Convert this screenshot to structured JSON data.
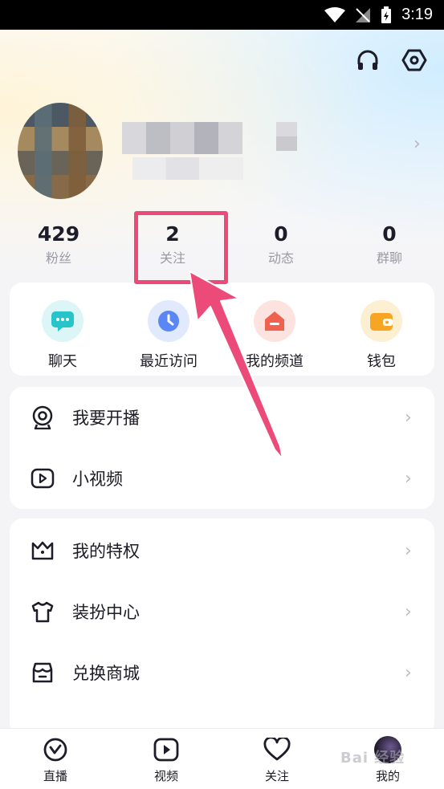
{
  "status_bar": {
    "time": "3:19"
  },
  "profile": {
    "stats": [
      {
        "value": "429",
        "label": "粉丝"
      },
      {
        "value": "2",
        "label": "关注"
      },
      {
        "value": "0",
        "label": "动态"
      },
      {
        "value": "0",
        "label": "群聊"
      }
    ]
  },
  "quick_actions": [
    {
      "label": "聊天",
      "icon": "chat-bubble-icon",
      "color": "#27c4c9"
    },
    {
      "label": "最近访问",
      "icon": "clock-icon",
      "color": "#5b86f5"
    },
    {
      "label": "我的频道",
      "icon": "channel-house-icon",
      "color": "#f0614e"
    },
    {
      "label": "钱包",
      "icon": "wallet-icon",
      "color": "#f6a623"
    }
  ],
  "menu_group_1": [
    {
      "label": "我要开播",
      "icon": "live-camera-icon"
    },
    {
      "label": "小视频",
      "icon": "video-play-icon"
    }
  ],
  "menu_group_2": [
    {
      "label": "我的特权",
      "icon": "crown-icon"
    },
    {
      "label": "装扮中心",
      "icon": "tshirt-icon"
    },
    {
      "label": "兑换商城",
      "icon": "store-icon"
    }
  ],
  "tabbar": [
    {
      "label": "直播",
      "icon": "live-check-icon"
    },
    {
      "label": "视频",
      "icon": "video-play-icon"
    },
    {
      "label": "关注",
      "icon": "heart-icon"
    },
    {
      "label": "我的",
      "icon": "avatar-icon"
    }
  ],
  "watermark": "Bai 经验",
  "colors": {
    "highlight": "#ec4a78",
    "accent": "#1d1d29"
  }
}
